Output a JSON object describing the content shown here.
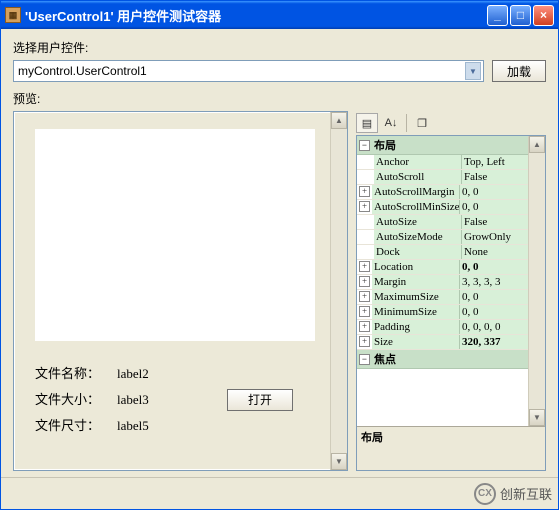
{
  "window": {
    "title": "'UserControl1' 用户控件测试容器"
  },
  "selectLabel": "选择用户控件:",
  "combo": {
    "value": "myControl.UserControl1"
  },
  "loadBtn": "加载",
  "previewLabel": "预览:",
  "fileInfo": {
    "nameLabel": "文件名称：",
    "nameValue": "label2",
    "sizeLabel": "文件大小：",
    "sizeValue": "label3",
    "dimLabel": "文件尺寸：",
    "dimValue": "label5",
    "openBtn": "打开"
  },
  "propGrid": {
    "toolbar": {
      "catIcon": "▤",
      "azIcon": "A↓",
      "pagesIcon": "❐"
    },
    "categories": [
      {
        "name": "布局",
        "expanded": true
      }
    ],
    "props": [
      {
        "expand": "",
        "name": "Anchor",
        "value": "Top, Left",
        "bold": false
      },
      {
        "expand": "",
        "name": "AutoScroll",
        "value": "False",
        "bold": false
      },
      {
        "expand": "+",
        "name": "AutoScrollMargin",
        "value": "0, 0",
        "bold": false
      },
      {
        "expand": "+",
        "name": "AutoScrollMinSize",
        "value": "0, 0",
        "bold": false
      },
      {
        "expand": "",
        "name": "AutoSize",
        "value": "False",
        "bold": false
      },
      {
        "expand": "",
        "name": "AutoSizeMode",
        "value": "GrowOnly",
        "bold": false
      },
      {
        "expand": "",
        "name": "Dock",
        "value": "None",
        "bold": false
      },
      {
        "expand": "+",
        "name": "Location",
        "value": "0, 0",
        "bold": true
      },
      {
        "expand": "+",
        "name": "Margin",
        "value": "3, 3, 3, 3",
        "bold": false
      },
      {
        "expand": "+",
        "name": "MaximumSize",
        "value": "0, 0",
        "bold": false
      },
      {
        "expand": "+",
        "name": "MinimumSize",
        "value": "0, 0",
        "bold": false
      },
      {
        "expand": "+",
        "name": "Padding",
        "value": "0, 0, 0, 0",
        "bold": false
      },
      {
        "expand": "+",
        "name": "Size",
        "value": "320, 337",
        "bold": true
      }
    ],
    "category2": "焦点",
    "descTitle": "布局",
    "descBody": ""
  },
  "footer": {
    "brand": "创新互联"
  }
}
